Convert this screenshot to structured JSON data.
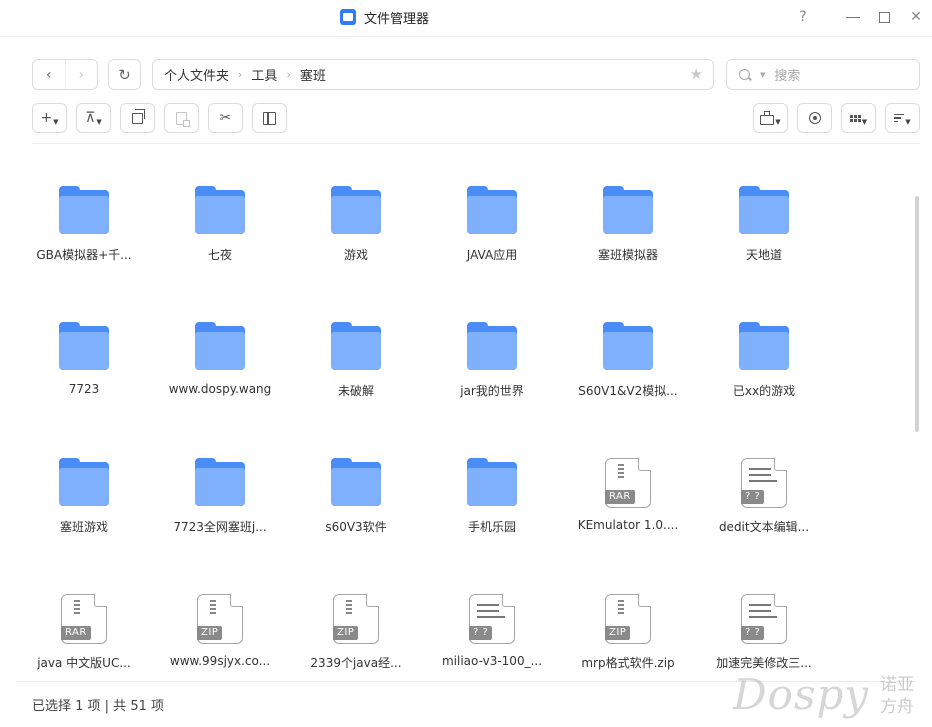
{
  "window": {
    "title": "文件管理器",
    "help": "?",
    "close": "✕"
  },
  "nav": {
    "back": "‹",
    "forward": "›",
    "refresh": "↻"
  },
  "breadcrumb": [
    "个人文件夹",
    "工具",
    "塞班"
  ],
  "breadcrumb_sep": "›",
  "search": {
    "placeholder": "搜索"
  },
  "toolbar": {
    "new": "+",
    "upload": "⊼",
    "cut": "✂"
  },
  "items": [
    {
      "type": "folder",
      "name": "GBA模拟器+千..."
    },
    {
      "type": "folder",
      "name": "七夜"
    },
    {
      "type": "folder",
      "name": "游戏"
    },
    {
      "type": "folder",
      "name": "JAVA应用"
    },
    {
      "type": "folder",
      "name": "塞班模拟器"
    },
    {
      "type": "folder",
      "name": "天地道"
    },
    {
      "type": "folder",
      "name": "7723"
    },
    {
      "type": "folder",
      "name": "www.dospy.wang"
    },
    {
      "type": "folder",
      "name": "未破解"
    },
    {
      "type": "folder",
      "name": "jar我的世界"
    },
    {
      "type": "folder",
      "name": "S60V1&V2模拟..."
    },
    {
      "type": "folder",
      "name": "已xx的游戏"
    },
    {
      "type": "folder",
      "name": "塞班游戏"
    },
    {
      "type": "folder",
      "name": "7723全网塞班j..."
    },
    {
      "type": "folder",
      "name": "s60V3软件"
    },
    {
      "type": "folder",
      "name": "手机乐园"
    },
    {
      "type": "archive",
      "badge": "RAR",
      "name": "KEmulator 1.0...."
    },
    {
      "type": "text",
      "badge": "? ?",
      "name": "dedit文本编辑..."
    },
    {
      "type": "archive",
      "badge": "RAR",
      "name": "java 中文版UC..."
    },
    {
      "type": "archive",
      "badge": "ZIP",
      "name": "www.99sjyx.co..."
    },
    {
      "type": "archive",
      "badge": "ZIP",
      "name": "2339个java经..."
    },
    {
      "type": "text",
      "badge": "? ?",
      "name": "miliao-v3-100_..."
    },
    {
      "type": "archive",
      "badge": "ZIP",
      "name": "mrp格式软件.zip"
    },
    {
      "type": "text",
      "badge": "? ?",
      "name": "加速完美修改三..."
    }
  ],
  "status": "已选择 1 项 | 共 51 项",
  "watermark": {
    "text": "Dospy",
    "cn": "诺亚方舟"
  }
}
